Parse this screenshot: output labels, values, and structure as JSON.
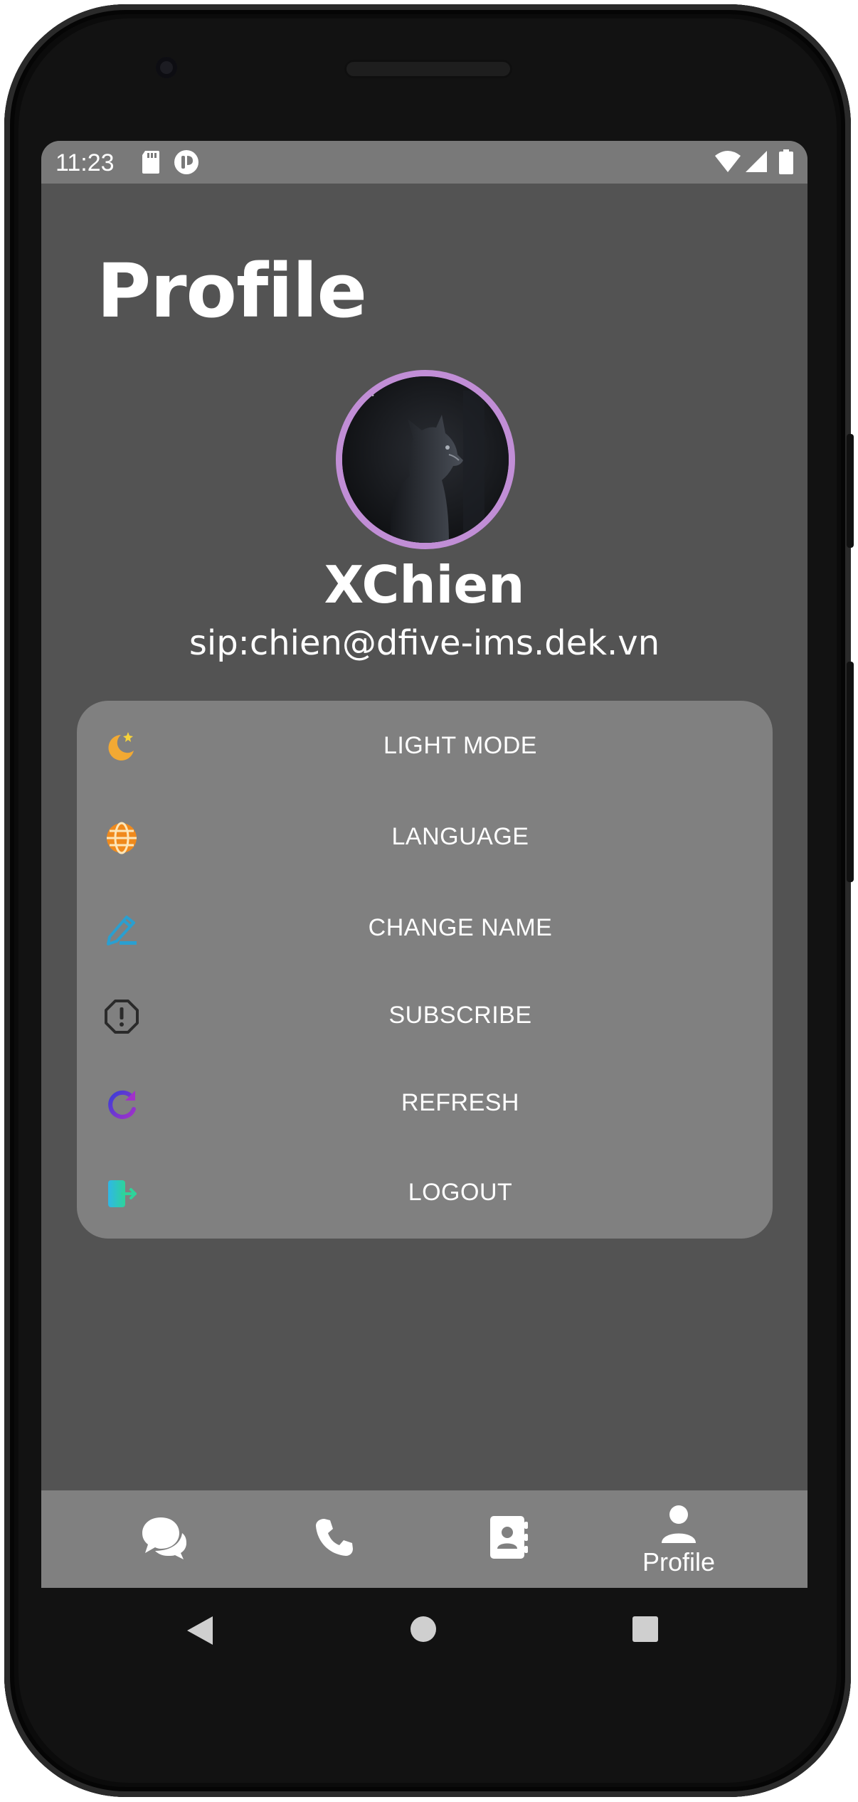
{
  "status_bar": {
    "time": "11:23",
    "icons": [
      "sd-card-icon",
      "app-notification-icon",
      "wifi-icon",
      "signal-icon",
      "battery-icon"
    ]
  },
  "page": {
    "title": "Profile"
  },
  "profile": {
    "name": "XChien",
    "sip": "sip:chien@dfive-ims.dek.vn",
    "avatar_ring_color": "#c18ed6"
  },
  "menu": {
    "items": [
      {
        "label": "LIGHT MODE",
        "icon": "moon-star-icon"
      },
      {
        "label": "LANGUAGE",
        "icon": "globe-icon"
      },
      {
        "label": "CHANGE NAME",
        "icon": "pencil-icon"
      },
      {
        "label": "SUBSCRIBE",
        "icon": "alert-octagon-icon"
      },
      {
        "label": "REFRESH",
        "icon": "refresh-icon"
      },
      {
        "label": "LOGOUT",
        "icon": "logout-icon"
      }
    ]
  },
  "bottom_nav": {
    "items": [
      {
        "icon": "chat-icon",
        "label": ""
      },
      {
        "icon": "phone-icon",
        "label": ""
      },
      {
        "icon": "contacts-icon",
        "label": ""
      },
      {
        "icon": "person-icon",
        "label": "Profile"
      }
    ],
    "active_index": 3
  },
  "system_nav": [
    "back-icon",
    "home-icon",
    "recents-icon"
  ],
  "colors": {
    "screen_bg": "#535353",
    "card_bg": "#808080",
    "status_bar_bg": "#797979",
    "accent": "#c18ed6"
  }
}
